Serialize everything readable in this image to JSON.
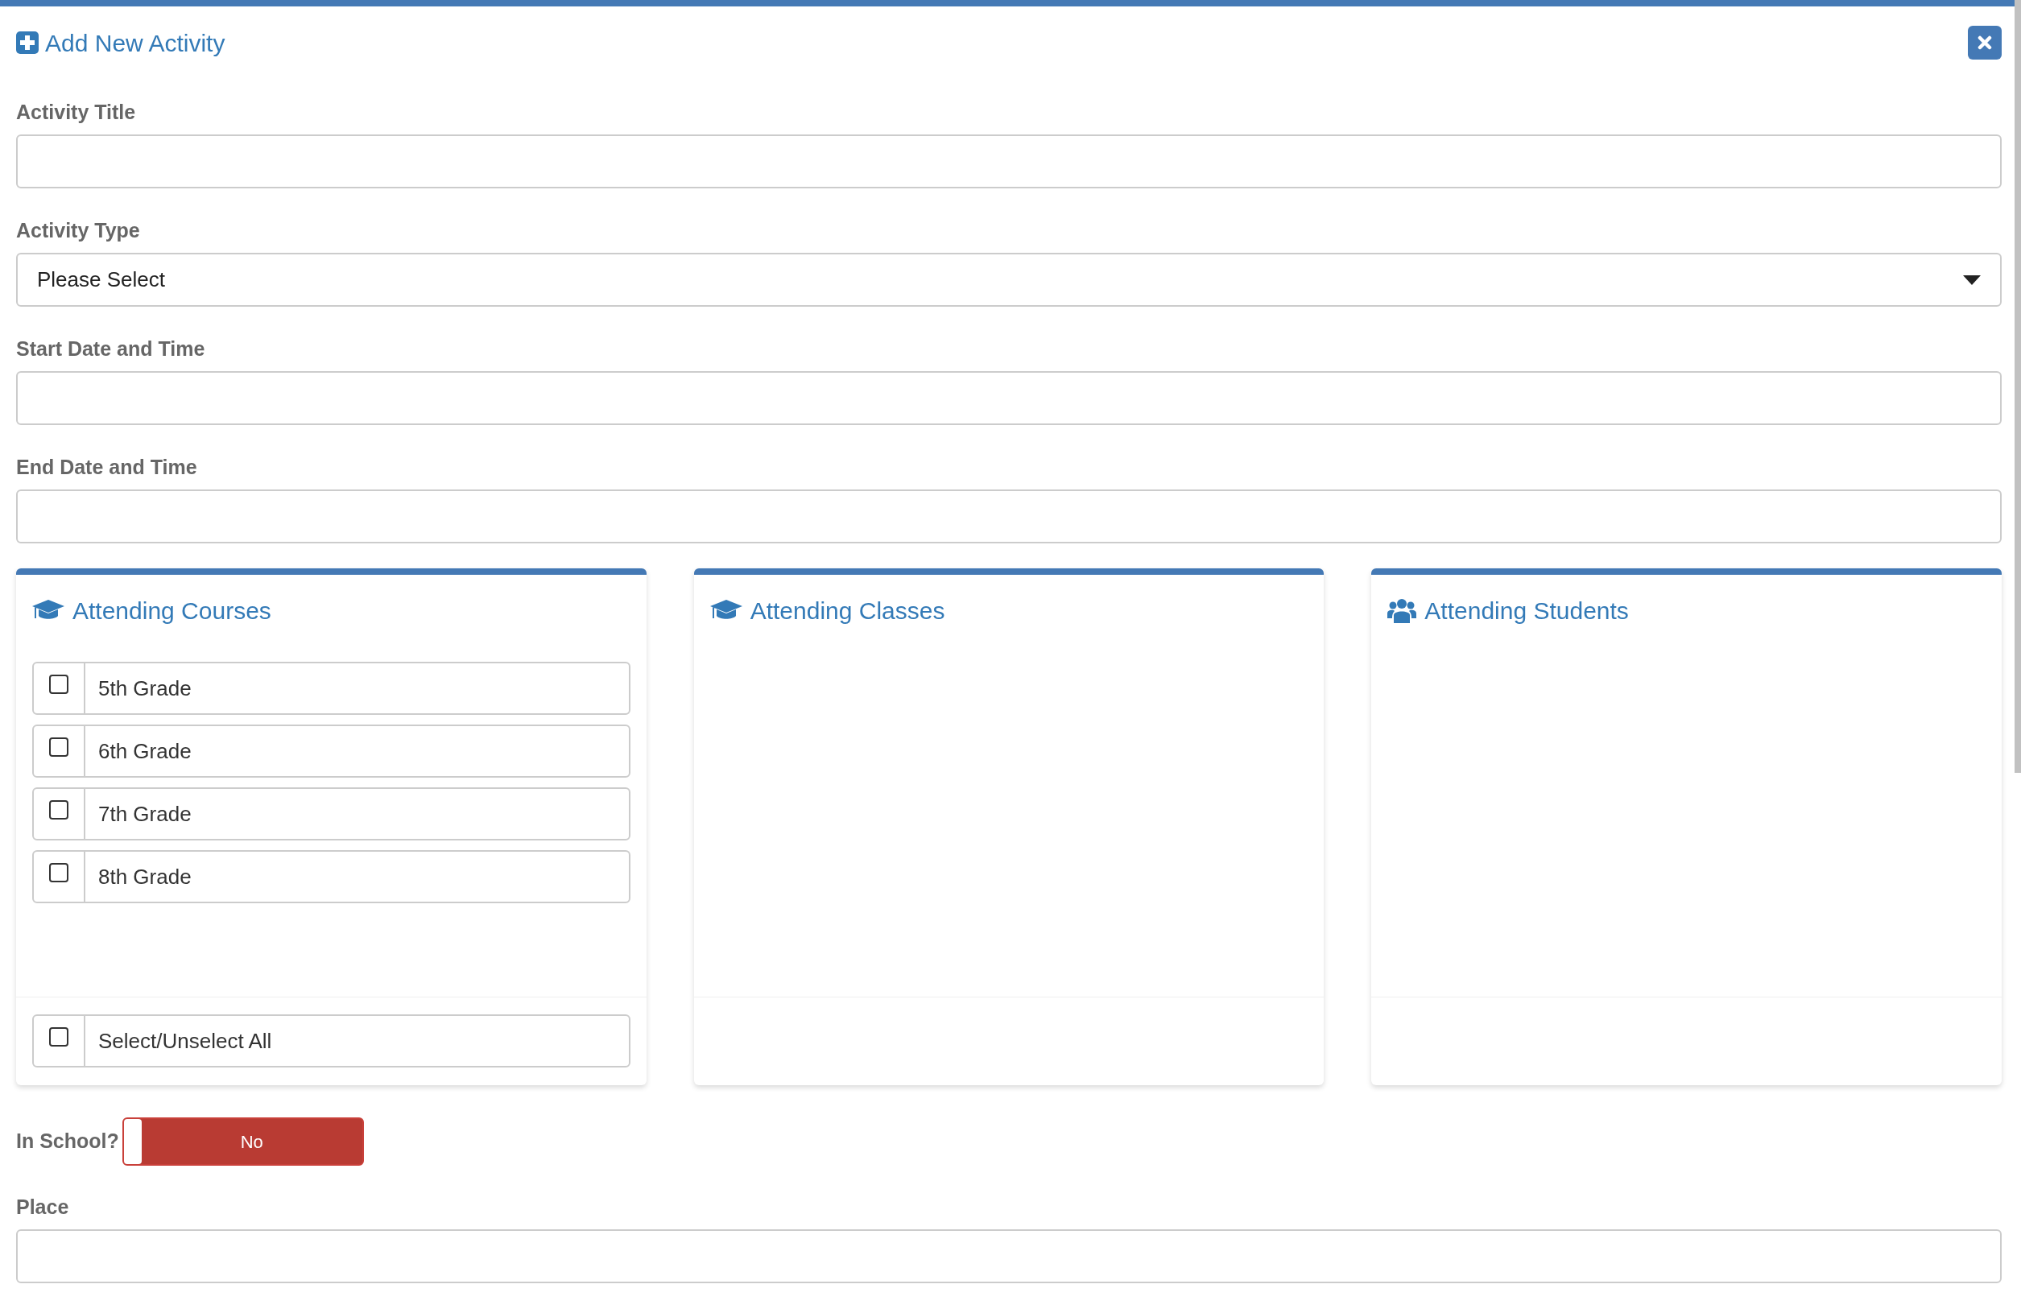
{
  "dialog": {
    "title": "Add New Activity"
  },
  "fields": [
    {
      "kind": "text",
      "label": "Activity Title"
    },
    {
      "kind": "select",
      "label": "Activity Type",
      "value": "Please Select"
    },
    {
      "kind": "text",
      "label": "Start Date and Time"
    },
    {
      "kind": "text",
      "label": "End Date and Time"
    }
  ],
  "panels": [
    {
      "kind": "courses",
      "title": "Attending Courses",
      "items": [
        {
          "label": "5th Grade",
          "checked": false
        },
        {
          "label": "6th Grade",
          "checked": false
        },
        {
          "label": "7th Grade",
          "checked": false
        },
        {
          "label": "8th Grade",
          "checked": false
        }
      ],
      "select_all": {
        "label": "Select/Unselect All",
        "checked": false
      }
    },
    {
      "kind": "classes",
      "title": "Attending Classes"
    },
    {
      "kind": "students",
      "title": "Attending Students"
    }
  ],
  "in_school": {
    "label": "In School?",
    "on": false,
    "text": "No"
  },
  "place": {
    "kind": "text",
    "label": "Place"
  }
}
